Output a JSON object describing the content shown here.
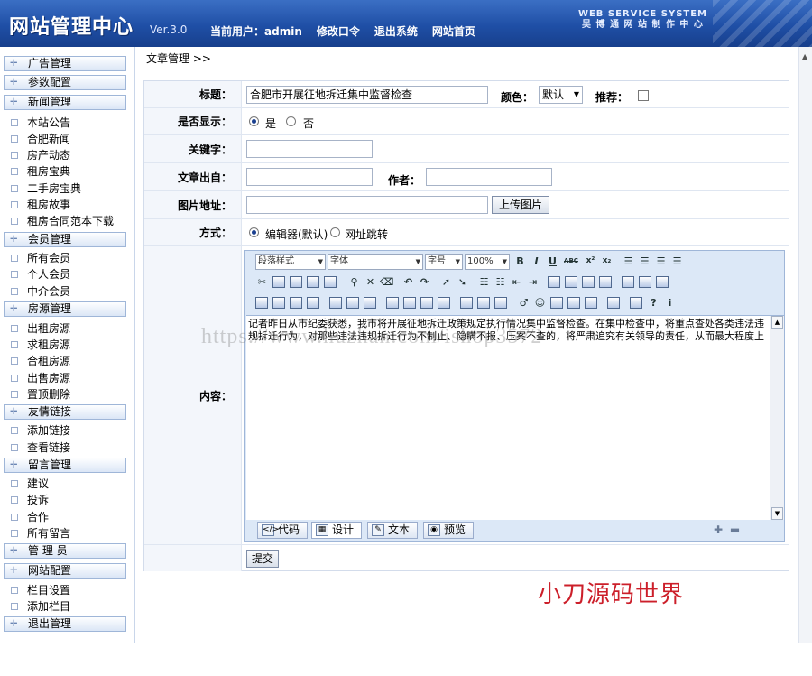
{
  "header": {
    "title": "网站管理中心",
    "version": "Ver.3.0",
    "current_user_label": "当前用户：",
    "current_user": "admin",
    "nav": [
      "修改口令",
      "退出系统",
      "网站首页"
    ],
    "system_en": "WEB SERVICE SYSTEM",
    "system_cn": "吴 博 通 网 站 制 作 中 心"
  },
  "sidebar": {
    "ad": "广告管理",
    "params": "参数配置",
    "news": "新闻管理",
    "news_items": [
      "本站公告",
      "合肥新闻",
      "房产动态",
      "租房宝典",
      "二手房宝典",
      "租房故事",
      "租房合同范本下载"
    ],
    "member": "会员管理",
    "member_items": [
      "所有会员",
      "个人会员",
      "中介会员"
    ],
    "house": "房源管理",
    "house_items": [
      "出租房源",
      "求租房源",
      "合租房源",
      "出售房源",
      "置顶删除"
    ],
    "links": "友情链接",
    "links_items": [
      "添加链接",
      "查看链接"
    ],
    "msg": "留言管理",
    "msg_items": [
      "建议",
      "投诉",
      "合作",
      "所有留言"
    ],
    "admin": "管 理 员",
    "site": "网站配置",
    "site_items": [
      "栏目设置",
      "添加栏目"
    ],
    "logout": "退出管理"
  },
  "breadcrumb": "文章管理 >>",
  "form": {
    "title_label": "标题：",
    "title_value": "合肥市开展征地拆迁集中监督检查",
    "color_label": "颜色：",
    "color_value": "默认",
    "recommend_label": "推荐：",
    "show_label": "是否显示：",
    "show_yes": "是",
    "show_no": "否",
    "keyword_label": "关键字：",
    "source_label": "文章出自：",
    "author_label": "作者：",
    "image_label": "图片地址：",
    "upload_button": "上传图片",
    "mode_label": "方式：",
    "mode_editor": "编辑器(默认)",
    "mode_link": "网址跳转",
    "content_label": "内容：",
    "submit": "提交"
  },
  "editor": {
    "para_style": "段落样式",
    "font": "字体",
    "size": "字号",
    "zoom": "100%",
    "bold": "B",
    "italic": "I",
    "underline": "U",
    "strike": "ABC",
    "sup": "x²",
    "sub": "x₂",
    "content_line1": "记者昨日从市纪委获悉，我市将开展征地拆迁政策规定执行情况集中监督检查。在集中检查中，将重点查处各类违法违",
    "content_line2": "规拆迁行为，对那些违法违规拆迁行为不制止、隐瞒不报、压案不查的，将严肃追究有关领导的责任，从而最大程度上",
    "tabs": [
      "代码",
      "设计",
      "文本",
      "预览"
    ],
    "tab_icons": [
      "</>",
      "▦",
      "✎",
      "◉"
    ],
    "zoom_plus": "✚",
    "zoom_minus": "▬"
  },
  "watermark": "https://www.huzhan.com/ishop3572",
  "signature": "小刀源码世界"
}
